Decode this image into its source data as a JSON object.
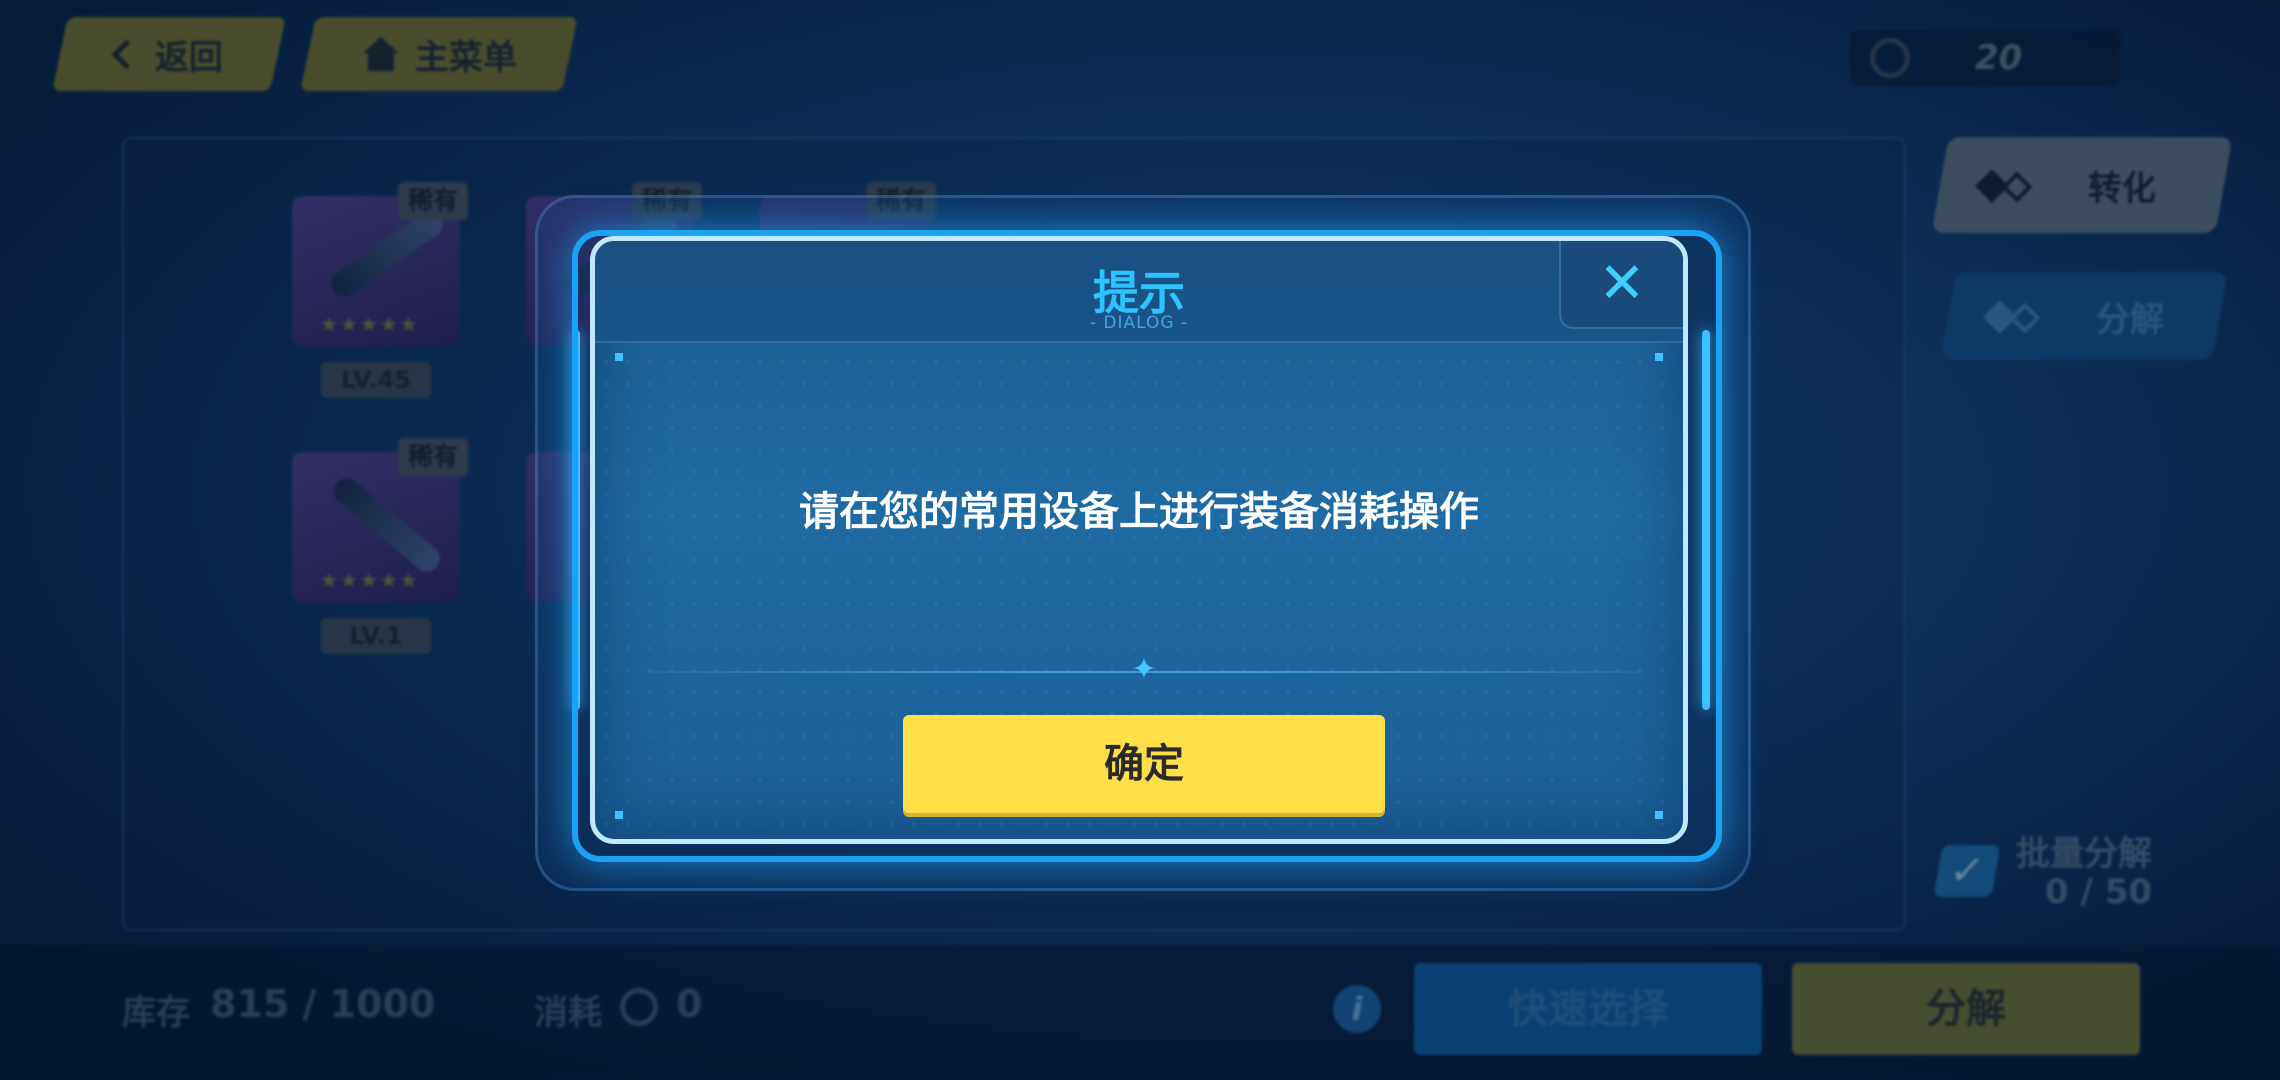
{
  "top_bar": {
    "back_label": "返回",
    "main_menu_label": "主菜单",
    "currency_value": "20"
  },
  "inventory": {
    "items": [
      {
        "rarity": "稀有",
        "level": "LV.45",
        "stars": "★★★★★"
      },
      {
        "rarity": "稀有",
        "level": "",
        "stars": ""
      },
      {
        "rarity": "稀有",
        "level": "",
        "stars": ""
      },
      {
        "rarity": "稀有",
        "level": "LV.1",
        "stars": "★★★★★"
      },
      {
        "rarity": "",
        "level": "",
        "stars": ""
      }
    ]
  },
  "side_panel": {
    "convert_label": "转化",
    "decompose_tab_label": "分解",
    "batch_label": "批量分解",
    "batch_count": "0 / 50"
  },
  "bottom_bar": {
    "stock_label": "库存",
    "stock_value": "815 / 1000",
    "cost_label": "消耗",
    "cost_value": "0",
    "info_icon": "i",
    "quick_select_label": "快速选择",
    "decompose_label": "分解"
  },
  "dialog": {
    "title": "提示",
    "subtitle": "- DIALOG -",
    "message": "请在您的常用设备上进行装备消耗操作",
    "confirm_label": "确定",
    "close_symbol": "✕"
  },
  "colors": {
    "accent_blue": "#2cc4ff",
    "confirm_yellow": "#ffdf47",
    "dialog_border": "#bfe8ff"
  }
}
